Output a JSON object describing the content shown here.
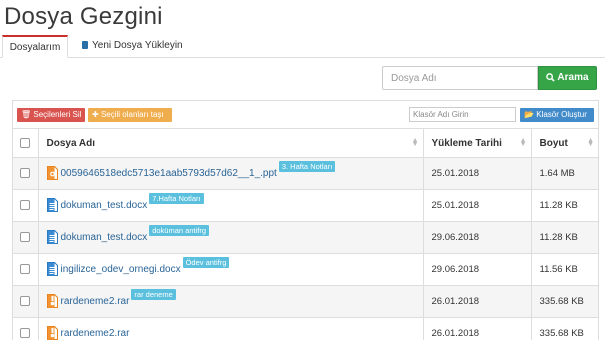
{
  "page": {
    "title": "Dosya Gezgini"
  },
  "tabs": [
    {
      "label": "Dosyalarım",
      "active": true
    },
    {
      "label": "Yeni Dosya Yükleyin",
      "icon": "document-icon"
    }
  ],
  "search": {
    "placeholder": "Dosya Adı",
    "button_label": "Arama",
    "button_icon": "search-icon"
  },
  "toolbar": {
    "delete_label": "Seçilenleri Sil",
    "move_label": "Seçili olanları taşı",
    "folder_placeholder": "Klasör Adı Girin",
    "create_folder_label": "Klasör Oluştur"
  },
  "table": {
    "headers": {
      "name": "Dosya Adı",
      "date": "Yükleme Tarihi",
      "size": "Boyut"
    },
    "rows": [
      {
        "icon": "presentation-file-icon",
        "name": "0059646518edc5713e1aab5793d57d62__1_.ppt",
        "tag": "3. Hafta Notları",
        "date": "25.01.2018",
        "size": "1.64 MB"
      },
      {
        "icon": "word-file-icon",
        "name": "dokuman_test.docx",
        "tag": "7.Hafta Notları",
        "date": "25.01.2018",
        "size": "11.28 KB"
      },
      {
        "icon": "word-file-icon",
        "name": "dokuman_test.docx",
        "tag": "doküman antifrg",
        "date": "29.06.2018",
        "size": "11.28 KB"
      },
      {
        "icon": "word-file-icon",
        "name": "ingilizce_odev_ornegi.docx",
        "tag": "Ödev antifrg",
        "date": "29.06.2018",
        "size": "11.56 KB"
      },
      {
        "icon": "archive-file-icon",
        "name": "rardeneme2.rar",
        "tag": "rar deneme",
        "date": "26.01.2018",
        "size": "335.68 KB"
      },
      {
        "icon": "archive-file-icon",
        "name": "rardeneme2.rar",
        "tag": "",
        "date": "26.01.2018",
        "size": "335.68 KB"
      }
    ]
  },
  "colors": {
    "accent_red": "#c9302c",
    "search_green": "#36a547",
    "delete_red": "#d9534f",
    "move_orange": "#f0ad4e",
    "folder_blue": "#428bca",
    "tag_blue": "#5bc0de",
    "link": "#2a6496"
  }
}
